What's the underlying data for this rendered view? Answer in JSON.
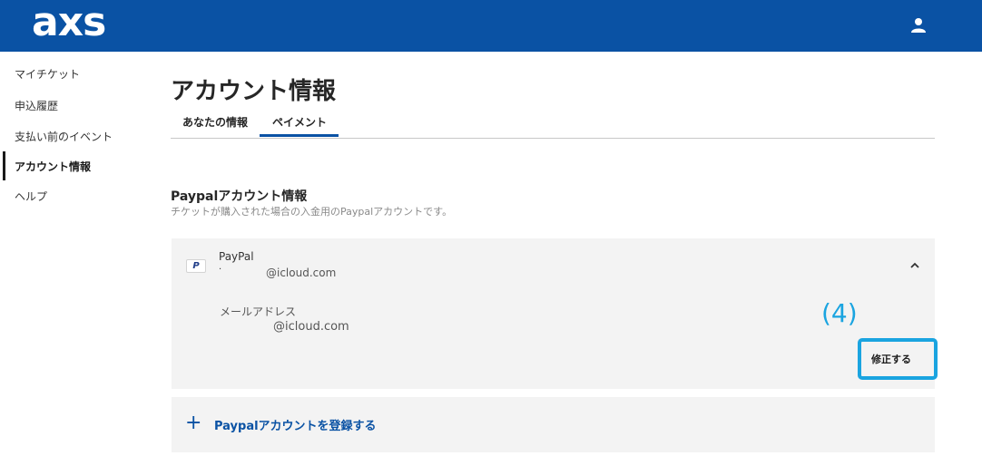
{
  "header": {
    "logo_text": "axs",
    "user_icon": "user-icon",
    "bg_color": "#0a52a4"
  },
  "sidebar": {
    "items": [
      {
        "label": "マイチケット"
      },
      {
        "label": "申込履歴"
      },
      {
        "label": "支払い前のイベント"
      },
      {
        "label": "アカウント情報",
        "active": true
      },
      {
        "label": "ヘルプ"
      }
    ]
  },
  "main": {
    "title": "アカウント情報",
    "tabs": [
      {
        "label": "あなたの情報"
      },
      {
        "label": "ペイメント",
        "active": true
      }
    ],
    "section": {
      "title": "Paypalアカウント情報",
      "subtitle": "チケットが購入された場合の入金用のPaypalアカウントです。"
    },
    "paypal_card": {
      "logo_glyph": "P",
      "name": "PayPal",
      "masked_prefix": "·",
      "email": "@icloud.com",
      "email_label": "メールアドレス",
      "email_value": "@icloud.com",
      "collapse_icon": "chevron-up-icon",
      "edit_label": "修正する"
    },
    "add_account": {
      "icon": "plus-icon",
      "label": "Paypalアカウントを登録する"
    }
  },
  "annotation": {
    "label": "(4)",
    "color": "#1aa4e0"
  }
}
